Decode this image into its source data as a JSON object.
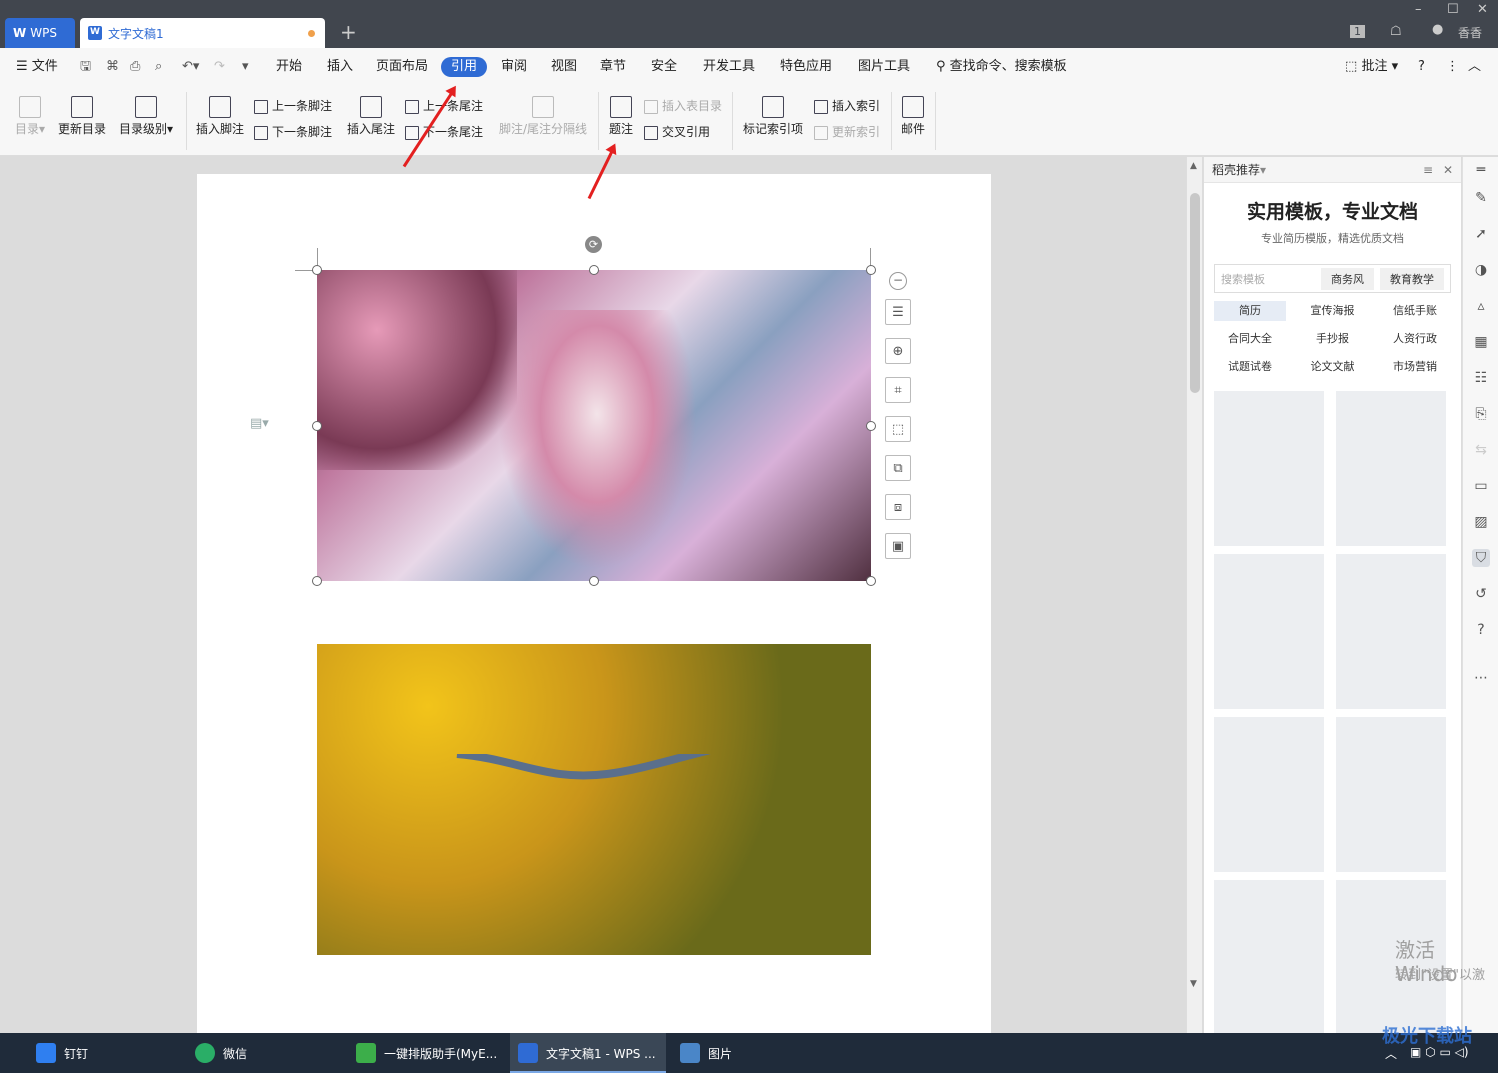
{
  "titlebar": {
    "wps_tab": "WPS",
    "doc_tab": "文字文稿1",
    "new_tab": "+",
    "user": "香香",
    "badge": "1"
  },
  "menubar": {
    "file": "文件",
    "items": [
      "开始",
      "插入",
      "页面布局",
      "引用",
      "审阅",
      "视图",
      "章节",
      "安全",
      "开发工具",
      "特色应用",
      "图片工具"
    ],
    "active": "引用",
    "search": "查找命令、搜索模板",
    "comment": "批注",
    "help": "?"
  },
  "ribbon": {
    "toc": "目录",
    "update_toc": "更新目录",
    "toc_level": "目录级别",
    "insert_footnote": "插入脚注",
    "prev_footnote": "上一条脚注",
    "next_footnote": "下一条脚注",
    "insert_endnote": "插入尾注",
    "prev_endnote": "上一条尾注",
    "next_endnote": "下一条尾注",
    "separator": "脚注/尾注分隔线",
    "caption": "题注",
    "insert_table_of_figures": "插入表目录",
    "cross_reference": "交叉引用",
    "mark_index": "标记索引项",
    "insert_index": "插入索引",
    "update_index": "更新索引",
    "mail": "邮件"
  },
  "panel": {
    "header": "稻壳推荐",
    "title": "实用模板，专业文档",
    "subtitle": "专业简历模版，精选优质文档",
    "search_placeholder": "搜索模板",
    "chips": [
      "商务风",
      "教育教学"
    ],
    "tags": [
      "简历",
      "宣传海报",
      "信纸手账",
      "合同大全",
      "手抄报",
      "人资行政",
      "试题试卷",
      "论文文献",
      "市场营销"
    ],
    "selected_tag": "简历"
  },
  "taskbar": {
    "items": [
      "钉钉",
      "微信",
      "一键排版助手(MyE...",
      "文字文稿1 - WPS ...",
      "图片"
    ]
  },
  "watermark": {
    "line1": "激活 Windo",
    "line2": "转到\"设置\"以激"
  },
  "brand": "极光下载站"
}
